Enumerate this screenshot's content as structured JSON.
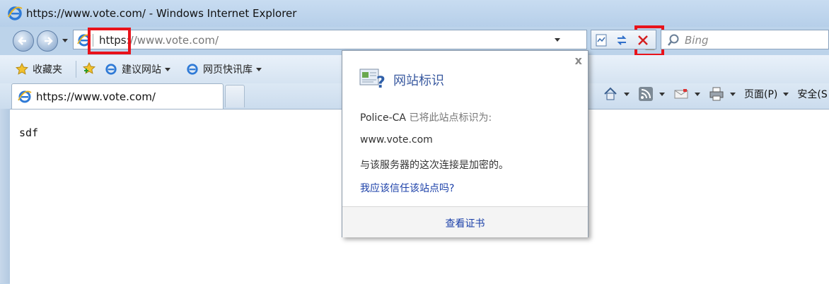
{
  "window": {
    "title": "https://www.vote.com/ - Windows Internet Explorer"
  },
  "address_bar": {
    "scheme": "https:",
    "rest": "//www.vote.com/"
  },
  "search": {
    "placeholder": "Bing"
  },
  "favorites_bar": {
    "favorites_label": "收藏夹",
    "items": [
      {
        "label": "建议网站"
      },
      {
        "label": "网页快讯库"
      }
    ]
  },
  "tab": {
    "label": "https://www.vote.com/"
  },
  "command_bar": {
    "page_label": "页面(P)",
    "safety_label": "安全(S"
  },
  "page": {
    "body_text": "sdf"
  },
  "site_identity_popup": {
    "close": "x",
    "title": "网站标识",
    "issuer": "Police-CA",
    "issuer_suffix": " 已将此站点标识为:",
    "site": "www.vote.com",
    "encryption_note": "与该服务器的这次连接是加密的。",
    "trust_question": "我应该信任该站点吗?",
    "view_certificate": "查看证书"
  },
  "colors": {
    "highlight_box": "#e8131b",
    "link": "#1a3fa8",
    "title_blue": "#3a5aa0"
  }
}
